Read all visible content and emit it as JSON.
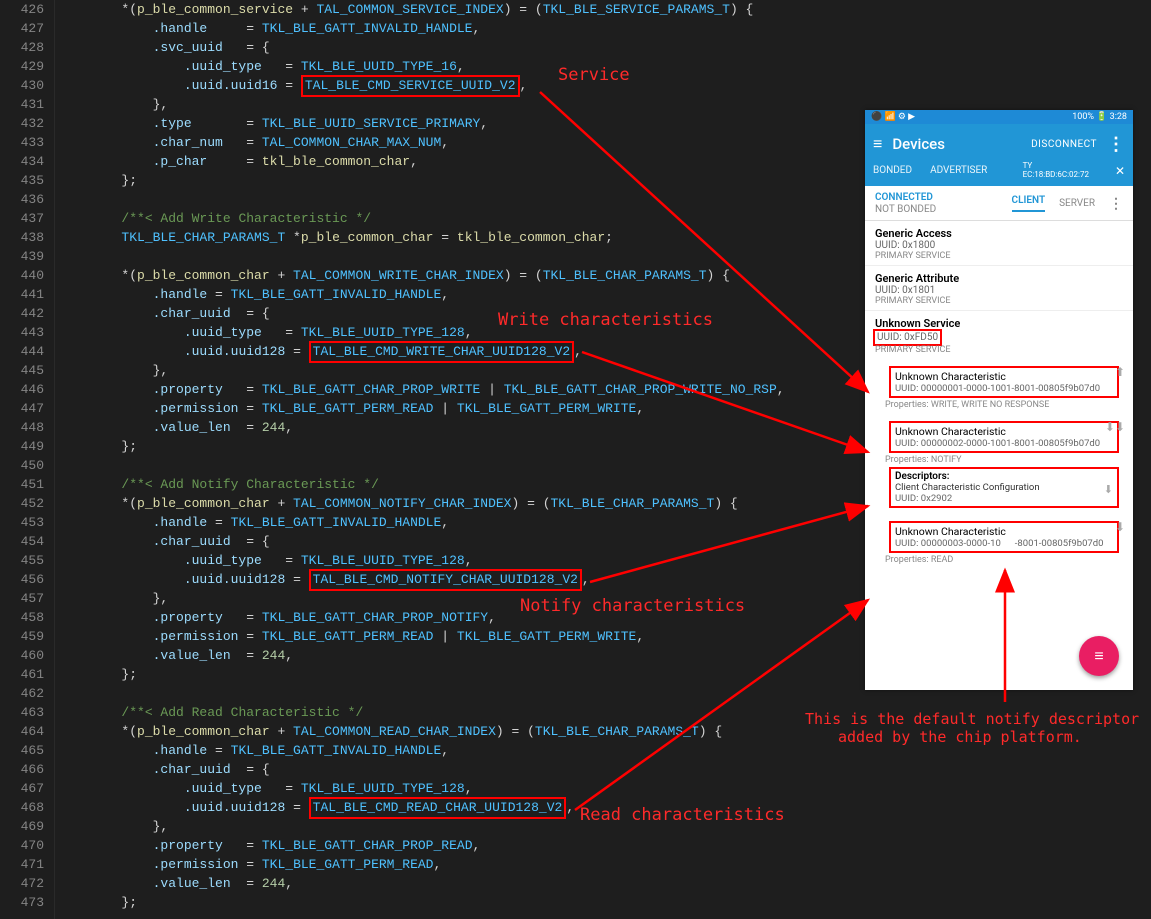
{
  "file": {
    "first_line": 426
  },
  "code": {
    "l426": "        *(p_ble_common_service + TAL_COMMON_SERVICE_INDEX) = (TKL_BLE_SERVICE_PARAMS_T) {",
    "l427": "            .handle     = TKL_BLE_GATT_INVALID_HANDLE,",
    "l428": "            .svc_uuid   = {",
    "l429": "                .uuid_type   = TKL_BLE_UUID_TYPE_16,",
    "l430a": "                .uuid.uuid16 = ",
    "l430b": "TAL_BLE_CMD_SERVICE_UUID_V2",
    "l430c": ",",
    "l431": "            },",
    "l432": "            .type       = TKL_BLE_UUID_SERVICE_PRIMARY,",
    "l433": "            .char_num   = TAL_COMMON_CHAR_MAX_NUM,",
    "l434": "            .p_char     = tkl_ble_common_char,",
    "l435": "        };",
    "l436": "",
    "l437": "        /**< Add Write Characteristic */",
    "l438": "        TKL_BLE_CHAR_PARAMS_T *p_ble_common_char = tkl_ble_common_char;",
    "l439": "",
    "l440": "        *(p_ble_common_char + TAL_COMMON_WRITE_CHAR_INDEX) = (TKL_BLE_CHAR_PARAMS_T) {",
    "l441": "            .handle = TKL_BLE_GATT_INVALID_HANDLE,",
    "l442": "            .char_uuid  = {",
    "l443": "                .uuid_type   = TKL_BLE_UUID_TYPE_128,",
    "l444a": "                .uuid.uuid128 = ",
    "l444b": "TAL_BLE_CMD_WRITE_CHAR_UUID128_V2",
    "l444c": ",",
    "l445": "            },",
    "l446": "            .property   = TKL_BLE_GATT_CHAR_PROP_WRITE | TKL_BLE_GATT_CHAR_PROP_WRITE_NO_RSP,",
    "l447": "            .permission = TKL_BLE_GATT_PERM_READ | TKL_BLE_GATT_PERM_WRITE,",
    "l448": "            .value_len  = 244,",
    "l449": "        };",
    "l450": "",
    "l451": "        /**< Add Notify Characteristic */",
    "l452": "        *(p_ble_common_char + TAL_COMMON_NOTIFY_CHAR_INDEX) = (TKL_BLE_CHAR_PARAMS_T) {",
    "l453": "            .handle = TKL_BLE_GATT_INVALID_HANDLE,",
    "l454": "            .char_uuid  = {",
    "l455": "                .uuid_type   = TKL_BLE_UUID_TYPE_128,",
    "l456a": "                .uuid.uuid128 = ",
    "l456b": "TAL_BLE_CMD_NOTIFY_CHAR_UUID128_V2",
    "l456c": ",",
    "l457": "            },",
    "l458": "            .property   = TKL_BLE_GATT_CHAR_PROP_NOTIFY,",
    "l459": "            .permission = TKL_BLE_GATT_PERM_READ | TKL_BLE_GATT_PERM_WRITE,",
    "l460": "            .value_len  = 244,",
    "l461": "        };",
    "l462": "",
    "l463": "        /**< Add Read Characteristic */",
    "l464": "        *(p_ble_common_char + TAL_COMMON_READ_CHAR_INDEX) = (TKL_BLE_CHAR_PARAMS_T) {",
    "l465": "            .handle = TKL_BLE_GATT_INVALID_HANDLE,",
    "l466": "            .char_uuid  = {",
    "l467": "                .uuid_type   = TKL_BLE_UUID_TYPE_128,",
    "l468a": "                .uuid.uuid128 = ",
    "l468b": "TAL_BLE_CMD_READ_CHAR_UUID128_V2",
    "l468c": ",",
    "l469": "            },",
    "l470": "            .property   = TKL_BLE_GATT_CHAR_PROP_READ,",
    "l471": "            .permission = TKL_BLE_GATT_PERM_READ,",
    "l472": "            .value_len  = 244,",
    "l473": "        };"
  },
  "annotations": {
    "service": "Service",
    "write": "Write characteristics",
    "notify": "Notify characteristics",
    "read": "Read characteristics",
    "descriptor1": "This is the default notify descriptor",
    "descriptor2": "added by the chip platform."
  },
  "phone": {
    "status_left": "⚫ 📶 ⚙ ▶",
    "status_right": "100% 🔋 3:28",
    "title": "Devices",
    "disconnect": "DISCONNECT",
    "tab_bonded": "BONDED",
    "tab_adv": "ADVERTISER",
    "tab_ty": "TY",
    "tab_mac": "EC:18:BD:6C:02:72",
    "connected": "CONNECTED",
    "not_bonded": "NOT BONDED",
    "client": "CLIENT",
    "server": "SERVER",
    "svc1_title": "Generic Access",
    "svc1_uuid": "UUID: 0x1800",
    "svc1_type": "PRIMARY SERVICE",
    "svc2_title": "Generic Attribute",
    "svc2_uuid": "UUID: 0x1801",
    "svc2_type": "PRIMARY SERVICE",
    "svc3_title": "Unknown Service",
    "svc3_uuid": "UUID: 0xFD50",
    "svc3_type": "PRIMARY SERVICE",
    "char1_title": "Unknown Characteristic",
    "char1_uuid": "UUID: 00000001-0000-1001-8001-00805f9b07d0",
    "char1_prop": "Properties: WRITE, WRITE NO RESPONSE",
    "char2_title": "Unknown Characteristic",
    "char2_uuid": "UUID: 00000002-0000-1001-8001-00805f9b07d0",
    "char2_prop": "Properties: NOTIFY",
    "desc_title": "Descriptors:",
    "desc_name": "Client Characteristic Configuration",
    "desc_uuid": "UUID: 0x2902",
    "char3_title": "Unknown Characteristic",
    "char3_uuid_a": "UUID: 00000003-0000-10",
    "char3_uuid_b": "-8001-00805f9b07d0",
    "char3_prop": "Properties: READ"
  }
}
